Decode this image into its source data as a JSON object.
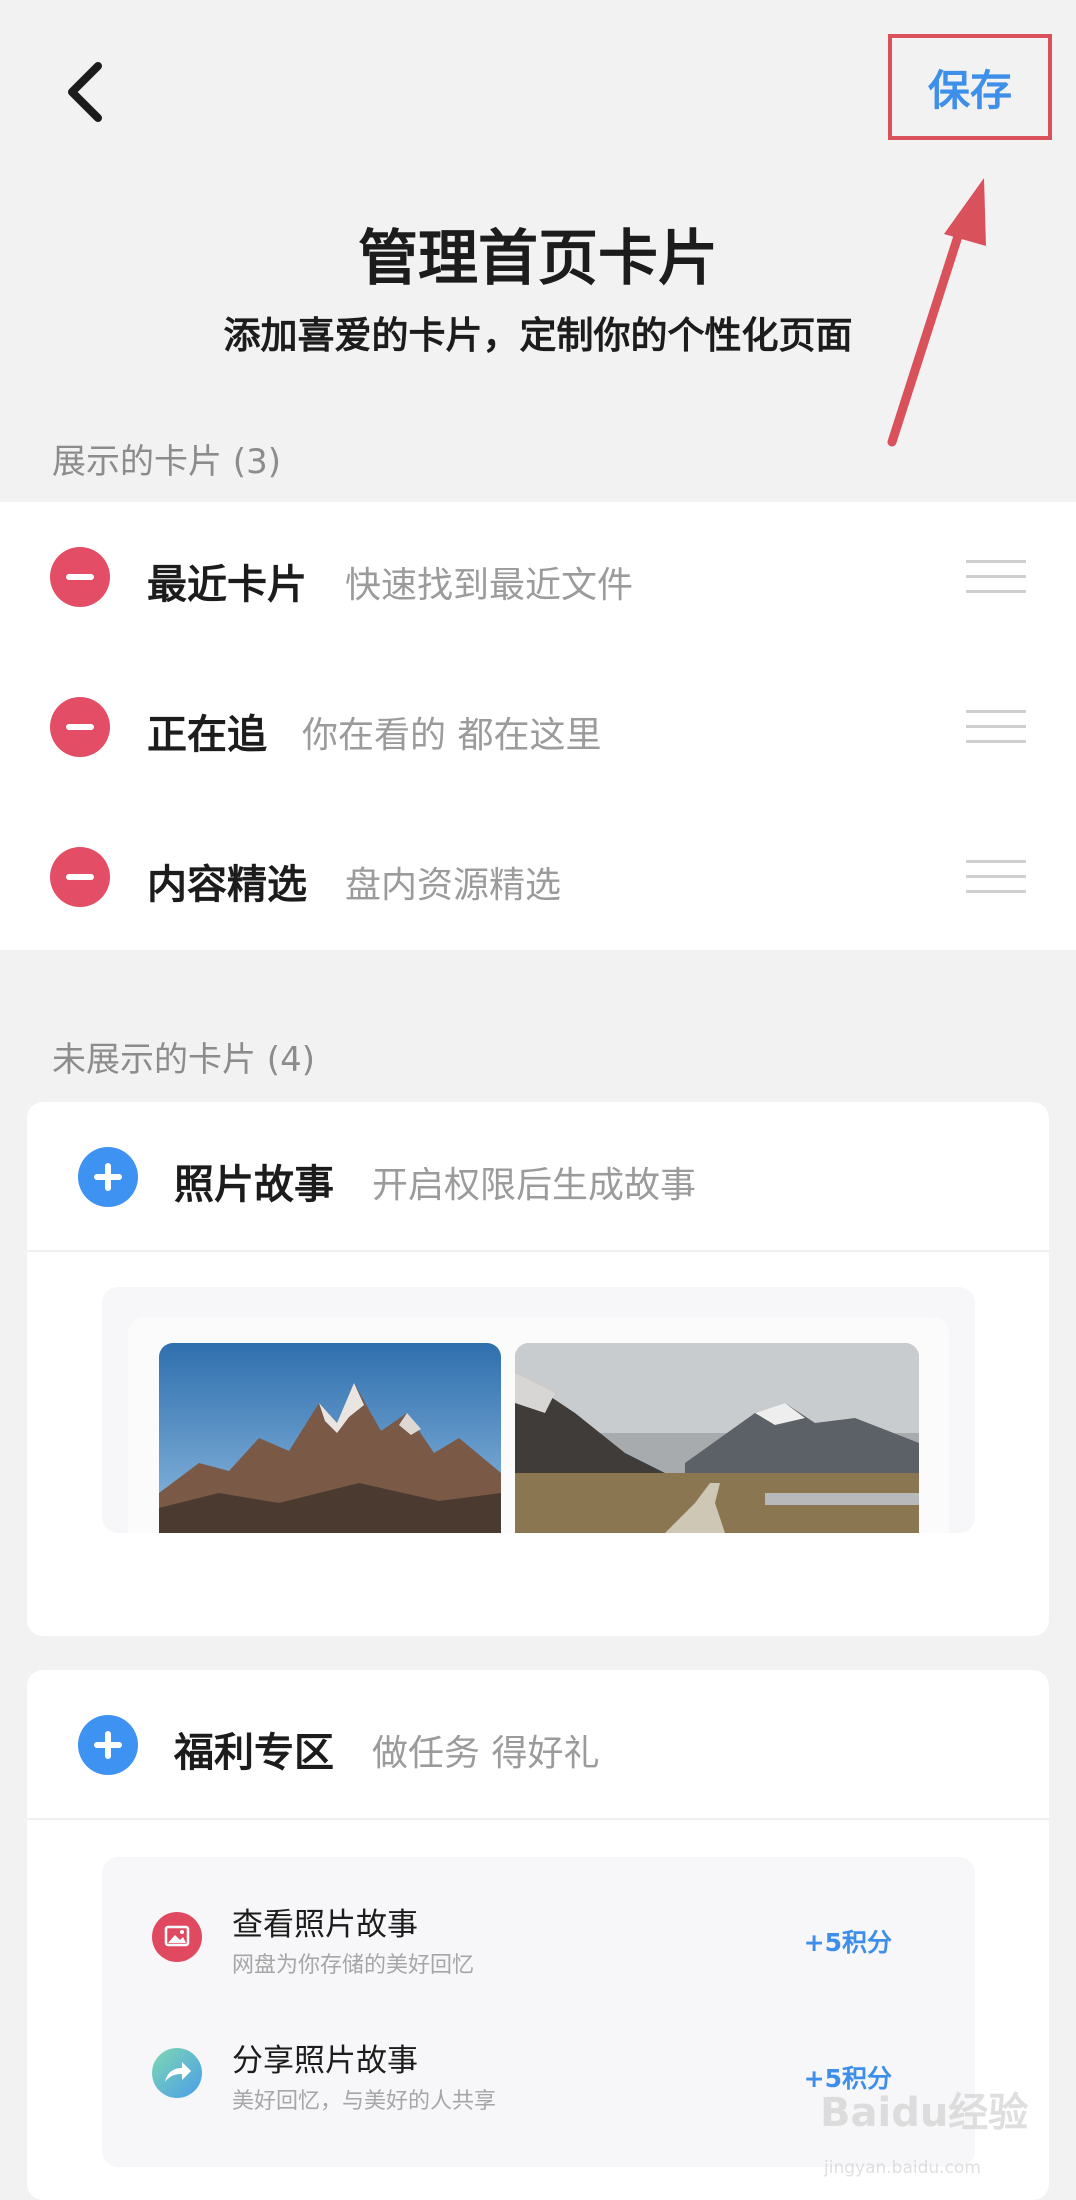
{
  "header": {
    "back_icon": "chevron-left-icon",
    "save_label": "保存",
    "annotation_color": "#d9515a",
    "title": "管理首页卡片",
    "subtitle": "添加喜爱的卡片，定制你的个性化页面"
  },
  "shown_section": {
    "label": "展示的卡片 (3)",
    "items": [
      {
        "title": "最近卡片",
        "desc": "快速找到最近文件"
      },
      {
        "title": "正在追",
        "desc": "你在看的 都在这里"
      },
      {
        "title": "内容精选",
        "desc": "盘内资源精选"
      }
    ]
  },
  "hidden_section": {
    "label": "未展示的卡片 (4)",
    "cards": [
      {
        "title": "照片故事",
        "desc": "开启权限后生成故事",
        "preview": [
          "mountain-peak-photo",
          "mountain-path-photo"
        ]
      },
      {
        "title": "福利专区",
        "desc": "做任务 得好礼",
        "tasks": [
          {
            "icon": "photo-icon",
            "title": "查看照片故事",
            "sub": "网盘为你存储的美好回忆",
            "reward": "+5积分"
          },
          {
            "icon": "share-icon",
            "title": "分享照片故事",
            "sub": "美好回忆，与美好的人共享",
            "reward": "+5积分"
          }
        ]
      }
    ]
  },
  "watermark": {
    "text": "Baidu经验",
    "url": "jingyan.baidu.com"
  },
  "colors": {
    "accent": "#3d8fe9",
    "remove": "#e34d65",
    "add": "#3e92f2",
    "background": "#f2f2f2"
  }
}
